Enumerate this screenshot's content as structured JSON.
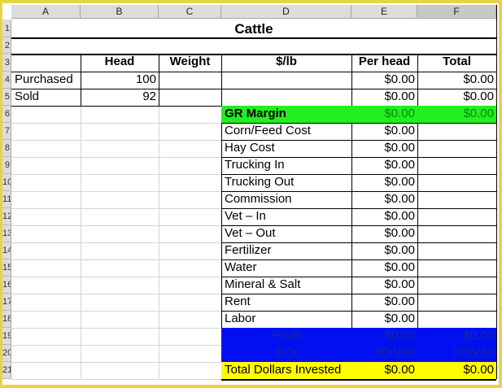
{
  "columns": [
    "A",
    "B",
    "C",
    "D",
    "E",
    "F"
  ],
  "rows": [
    "1",
    "2",
    "3",
    "4",
    "5",
    "6",
    "7",
    "8",
    "9",
    "10",
    "11",
    "12",
    "13",
    "14",
    "15",
    "16",
    "17",
    "18",
    "19",
    "20",
    "21"
  ],
  "title": "Cattle",
  "headers": {
    "head": "Head",
    "weight": "Weight",
    "per_lb": "$/lb",
    "per_head": "Per head",
    "total": "Total"
  },
  "purchased": {
    "label": "Purchased",
    "head": "100",
    "per_head": "$0.00",
    "total": "$0.00"
  },
  "sold": {
    "label": "Sold",
    "head": "92",
    "per_head": "$0.00",
    "total": "$0.00"
  },
  "gr_margin": {
    "label": "GR Margin",
    "per_head": "$0.00",
    "total": "$0.00"
  },
  "expenses": [
    {
      "label": "Corn/Feed Cost",
      "per_head": "$0.00"
    },
    {
      "label": "Hay Cost",
      "per_head": "$0.00"
    },
    {
      "label": "Trucking In",
      "per_head": "$0.00"
    },
    {
      "label": "Trucking Out",
      "per_head": "$0.00"
    },
    {
      "label": "Commission",
      "per_head": "$0.00"
    },
    {
      "label": "Vet – In",
      "per_head": "$0.00"
    },
    {
      "label": "Vet – Out",
      "per_head": "$0.00"
    },
    {
      "label": "Fertilizer",
      "per_head": "$0.00"
    },
    {
      "label": "Water",
      "per_head": "$0.00"
    },
    {
      "label": "Mineral & Salt",
      "per_head": "$0.00"
    },
    {
      "label": "Rent",
      "per_head": "$0.00"
    },
    {
      "label": "Labor",
      "per_head": "$0.00"
    }
  ],
  "profit": {
    "label": "Profit",
    "per_head": "$0.00",
    "total": "$0.00"
  },
  "roi": {
    "label": "ROI",
    "per_head": "#DIV/0!",
    "total": "#DIV/0!"
  },
  "total_invested": {
    "label": "Total Dollars Invested",
    "per_head": "$0.00",
    "total": "$0.00"
  },
  "colors": {
    "green": "#22ee22",
    "blue": "#0010ee",
    "yellow": "#ffff00",
    "frame": "#e8d24a"
  }
}
